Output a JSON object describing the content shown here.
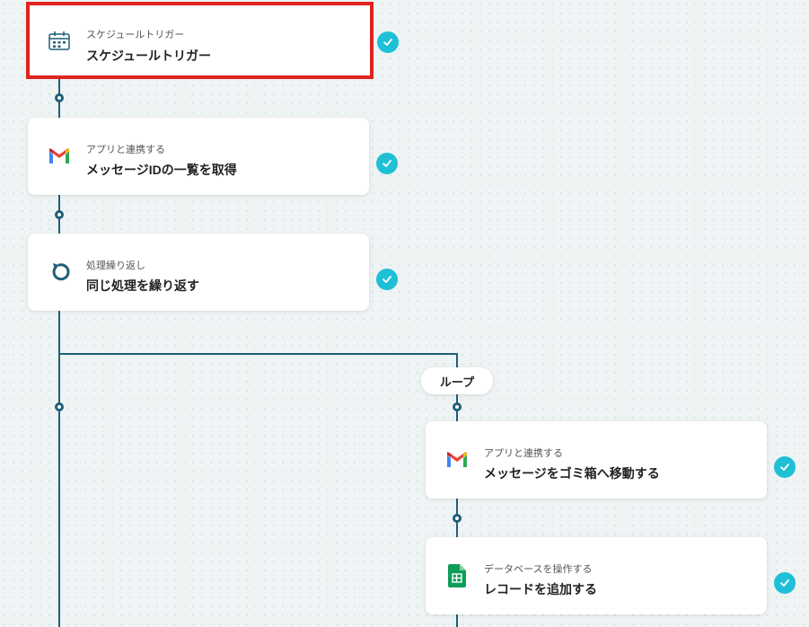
{
  "steps": [
    {
      "sub": "スケジュールトリガー",
      "title": "スケジュールトリガー",
      "icon": "calendar-clock-icon"
    },
    {
      "sub": "アプリと連携する",
      "title": "メッセージIDの一覧を取得",
      "icon": "gmail-icon"
    },
    {
      "sub": "処理繰り返し",
      "title": "同じ処理を繰り返す",
      "icon": "loop-arrow-icon"
    },
    {
      "sub": "アプリと連携する",
      "title": "メッセージをゴミ箱へ移動する",
      "icon": "gmail-icon"
    },
    {
      "sub": "データベースを操作する",
      "title": "レコードを追加する",
      "icon": "google-sheets-icon"
    }
  ],
  "loop_label": "ループ",
  "colors": {
    "connector": "#1f5f78",
    "check": "#1fc0d6",
    "highlight": "#e0231f"
  }
}
